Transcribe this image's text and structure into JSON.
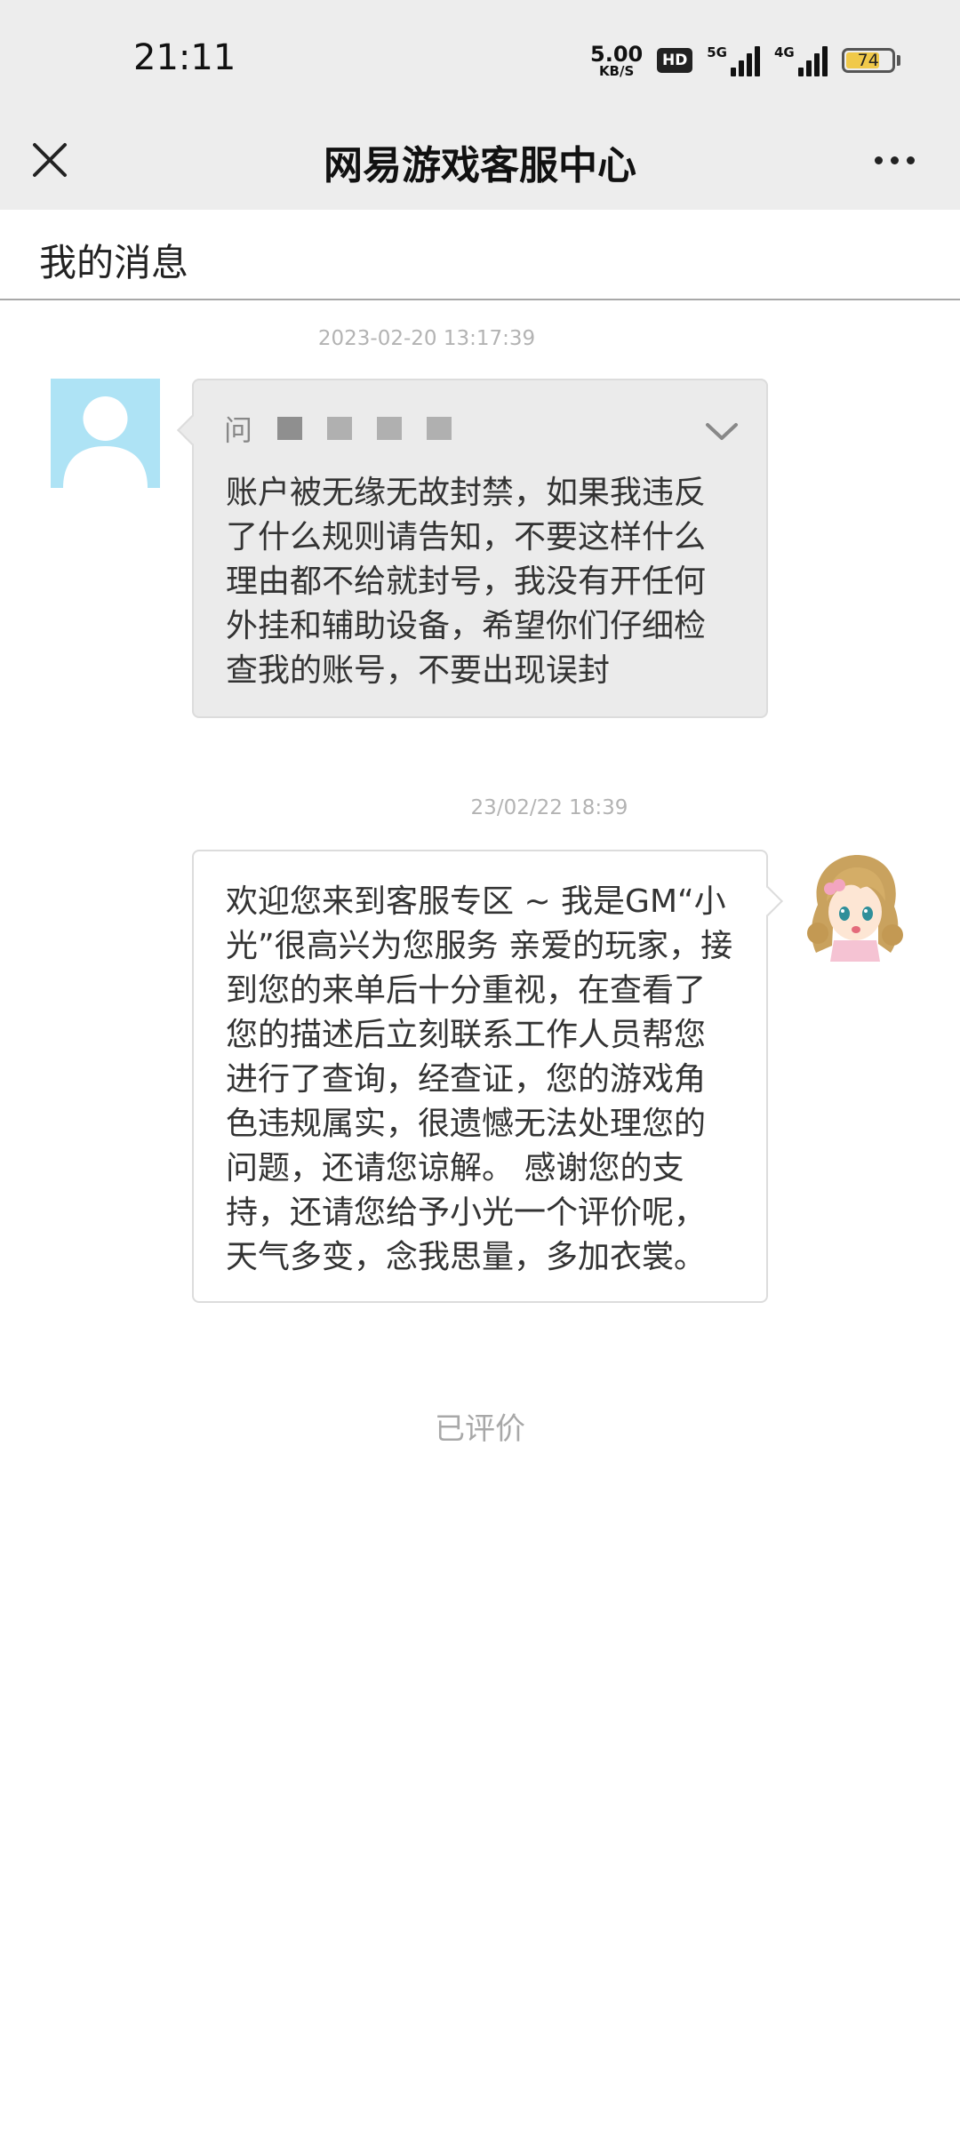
{
  "status_bar": {
    "time": "21:11",
    "net_speed_value": "5.00",
    "net_speed_unit": "KB/S",
    "hd_label": "HD",
    "signal1_label": "5G",
    "signal2_label": "4G",
    "battery_percent": "74",
    "battery_color": "#f0c94a"
  },
  "header": {
    "title": "网易游戏客服中心",
    "close_icon": "close-icon",
    "more_icon": "more-dots-icon"
  },
  "section": {
    "title": "我的消息"
  },
  "messages": [
    {
      "timestamp": "2023-02-20 13:17:39",
      "sender": "user",
      "label": "问",
      "text": "账户被无缘无故封禁，如果我违反了什么规则请告知，不要这样什么理由都不给就封号，我没有开任何外挂和辅助设备，希望你们仔细检查我的账号，不要出现误封"
    },
    {
      "timestamp": "23/02/22 18:39",
      "sender": "gm",
      "text": "欢迎您来到客服专区 ~ 我是GM“小光”很高兴为您服务 亲爱的玩家，接到您的来单后十分重视，在查看了您的描述后立刻联系工作人员帮您进行了查询，经查证，您的游戏角色违规属实，很遗憾无法处理您的问题，还请您谅解。 感谢您的支持，还请您给予小光一个评价呢，天气多变，念我思量，多加衣裳。"
    }
  ],
  "footer": {
    "rated_label": "已评价"
  }
}
